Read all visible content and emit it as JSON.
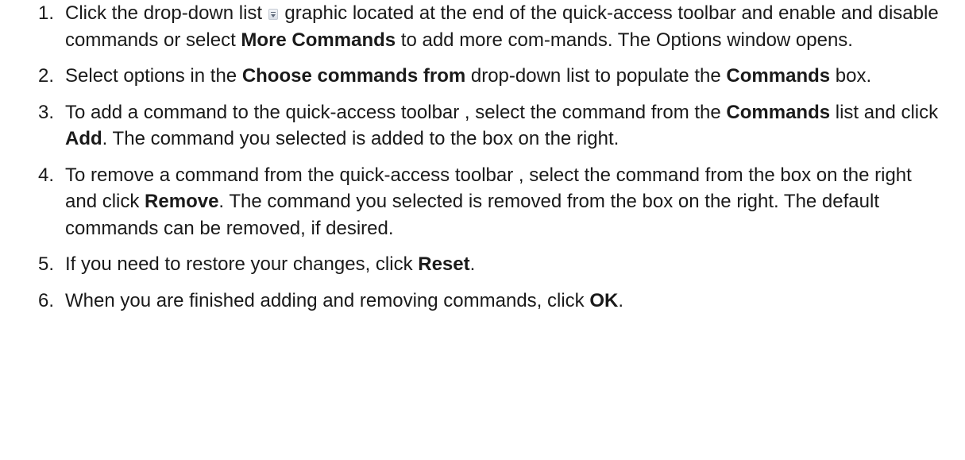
{
  "steps": [
    {
      "num": "1.",
      "t1": "Click the drop-down list ",
      "icon": "dropdown-list-icon",
      "t2": " graphic located at the end of the quick-access toolbar and enable and disable commands or select ",
      "b1": "More Commands",
      "t3": " to add more com-mands. The Options window opens."
    },
    {
      "num": "2.",
      "t1": "Select options in the ",
      "b1": "Choose commands from",
      "t2": " drop-down list to populate the ",
      "b2": "Commands",
      "t3": " box."
    },
    {
      "num": "3.",
      "t1": "To add a command to the quick-access toolbar , select the command from the ",
      "b1": "Commands",
      "t2": " list and click ",
      "b2": "Add",
      "t3": ". The command you selected is added to the box on the right."
    },
    {
      "num": "4.",
      "t1": "To remove a command from the quick-access toolbar , select the command from the box on the right and click ",
      "b1": "Remove",
      "t2": ". The command you selected is removed from the box on the right. The default commands can be removed, if desired."
    },
    {
      "num": "5.",
      "t1": "If you need to restore your changes, click ",
      "b1": "Reset",
      "t2": "."
    },
    {
      "num": "6.",
      "t1": "When you are finished adding and removing commands, click ",
      "b1": "OK",
      "t2": "."
    }
  ]
}
